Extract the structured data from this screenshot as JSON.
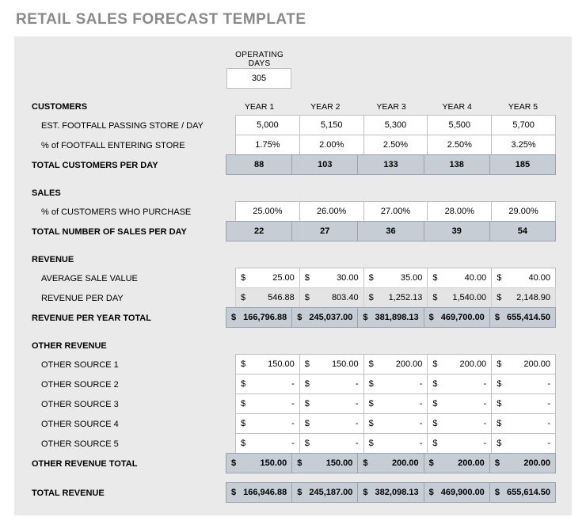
{
  "title": "RETAIL SALES FORECAST TEMPLATE",
  "operating": {
    "label": "OPERATING DAYS",
    "value": "305"
  },
  "years": [
    "YEAR 1",
    "YEAR 2",
    "YEAR 3",
    "YEAR 4",
    "YEAR 5"
  ],
  "sections": {
    "customers": {
      "header": "CUSTOMERS",
      "footfall": {
        "label": "EST. FOOTFALL PASSING STORE / DAY",
        "values": [
          "5,000",
          "5,150",
          "5,300",
          "5,500",
          "5,700"
        ]
      },
      "pctentry": {
        "label": "% of FOOTFALL ENTERING STORE",
        "values": [
          "1.75%",
          "2.00%",
          "2.50%",
          "2.50%",
          "3.25%"
        ]
      },
      "total": {
        "label": "TOTAL CUSTOMERS PER DAY",
        "values": [
          "88",
          "103",
          "133",
          "138",
          "185"
        ]
      }
    },
    "sales": {
      "header": "SALES",
      "pctpurchase": {
        "label": "% of CUSTOMERS WHO PURCHASE",
        "values": [
          "25.00%",
          "26.00%",
          "27.00%",
          "28.00%",
          "29.00%"
        ]
      },
      "total": {
        "label": "TOTAL NUMBER OF SALES PER DAY",
        "values": [
          "22",
          "27",
          "36",
          "39",
          "54"
        ]
      }
    },
    "revenue": {
      "header": "REVENUE",
      "avg": {
        "label": "AVERAGE SALE VALUE",
        "cur": "$",
        "values": [
          "25.00",
          "30.00",
          "35.00",
          "40.00",
          "40.00"
        ]
      },
      "perday": {
        "label": "REVENUE PER DAY",
        "cur": "$",
        "values": [
          "546.88",
          "803.40",
          "1,252.13",
          "1,540.00",
          "2,148.90"
        ]
      },
      "yeartotal": {
        "label": "REVENUE PER YEAR TOTAL",
        "cur": "$",
        "values": [
          "166,796.88",
          "245,037.00",
          "381,898.13",
          "469,700.00",
          "655,414.50"
        ]
      }
    },
    "other": {
      "header": "OTHER REVENUE",
      "sources": [
        {
          "label": "OTHER SOURCE 1",
          "cur": "$",
          "values": [
            "150.00",
            "150.00",
            "200.00",
            "200.00",
            "200.00"
          ]
        },
        {
          "label": "OTHER SOURCE 2",
          "cur": "$",
          "values": [
            "-",
            "-",
            "-",
            "-",
            "-"
          ]
        },
        {
          "label": "OTHER SOURCE 3",
          "cur": "$",
          "values": [
            "-",
            "-",
            "-",
            "-",
            "-"
          ]
        },
        {
          "label": "OTHER SOURCE 4",
          "cur": "$",
          "values": [
            "-",
            "-",
            "-",
            "-",
            "-"
          ]
        },
        {
          "label": "OTHER SOURCE 5",
          "cur": "$",
          "values": [
            "-",
            "-",
            "-",
            "-",
            "-"
          ]
        }
      ],
      "total": {
        "label": "OTHER REVENUE TOTAL",
        "cur": "$",
        "values": [
          "150.00",
          "150.00",
          "200.00",
          "200.00",
          "200.00"
        ]
      }
    },
    "totalrevenue": {
      "label": "TOTAL REVENUE",
      "cur": "$",
      "values": [
        "166,946.88",
        "245,187.00",
        "382,098.13",
        "469,900.00",
        "655,614.50"
      ]
    }
  },
  "chart_data": {
    "type": "table",
    "title": "Retail Sales Forecast",
    "operating_days": 305,
    "series": [
      {
        "name": "Est. footfall passing store / day",
        "values": [
          5000,
          5150,
          5300,
          5500,
          5700
        ]
      },
      {
        "name": "% of footfall entering store",
        "values": [
          1.75,
          2.0,
          2.5,
          2.5,
          3.25
        ]
      },
      {
        "name": "Total customers per day",
        "values": [
          88,
          103,
          133,
          138,
          185
        ]
      },
      {
        "name": "% of customers who purchase",
        "values": [
          25.0,
          26.0,
          27.0,
          28.0,
          29.0
        ]
      },
      {
        "name": "Total number of sales per day",
        "values": [
          22,
          27,
          36,
          39,
          54
        ]
      },
      {
        "name": "Average sale value ($)",
        "values": [
          25.0,
          30.0,
          35.0,
          40.0,
          40.0
        ]
      },
      {
        "name": "Revenue per day ($)",
        "values": [
          546.88,
          803.4,
          1252.13,
          1540.0,
          2148.9
        ]
      },
      {
        "name": "Revenue per year total ($)",
        "values": [
          166796.88,
          245037.0,
          381898.13,
          469700.0,
          655414.5
        ]
      },
      {
        "name": "Other source 1 ($)",
        "values": [
          150.0,
          150.0,
          200.0,
          200.0,
          200.0
        ]
      },
      {
        "name": "Other source 2 ($)",
        "values": [
          0,
          0,
          0,
          0,
          0
        ]
      },
      {
        "name": "Other source 3 ($)",
        "values": [
          0,
          0,
          0,
          0,
          0
        ]
      },
      {
        "name": "Other source 4 ($)",
        "values": [
          0,
          0,
          0,
          0,
          0
        ]
      },
      {
        "name": "Other source 5 ($)",
        "values": [
          0,
          0,
          0,
          0,
          0
        ]
      },
      {
        "name": "Other revenue total ($)",
        "values": [
          150.0,
          150.0,
          200.0,
          200.0,
          200.0
        ]
      },
      {
        "name": "Total revenue ($)",
        "values": [
          166946.88,
          245187.0,
          382098.13,
          469900.0,
          655614.5
        ]
      }
    ],
    "categories": [
      "Year 1",
      "Year 2",
      "Year 3",
      "Year 4",
      "Year 5"
    ]
  }
}
